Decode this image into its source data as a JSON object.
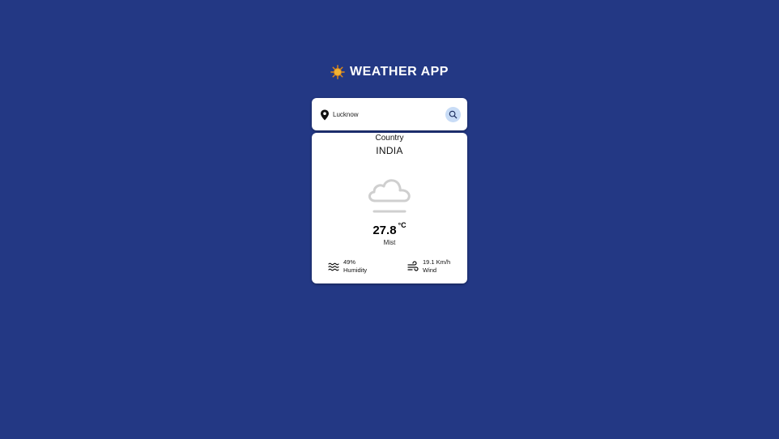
{
  "header": {
    "logo_icon": "sun-icon",
    "title": "WEATHER APP"
  },
  "search": {
    "location_icon": "location-pin-icon",
    "value": "Lucknow",
    "button_icon": "search-icon"
  },
  "card": {
    "country_label": "Country",
    "country": "INDIA",
    "weather_icon": "cloud-mist-icon",
    "temperature": "27.8",
    "unit": "°C",
    "condition": "Mist",
    "humidity": {
      "icon": "humidity-waves-icon",
      "value": "49%",
      "label": "Humidity"
    },
    "wind": {
      "icon": "wind-icon",
      "value": "19.1 Km/h",
      "label": "Wind"
    }
  },
  "colors": {
    "background": "#233884",
    "card": "#ffffff",
    "search_button": "#c8dcf6"
  }
}
